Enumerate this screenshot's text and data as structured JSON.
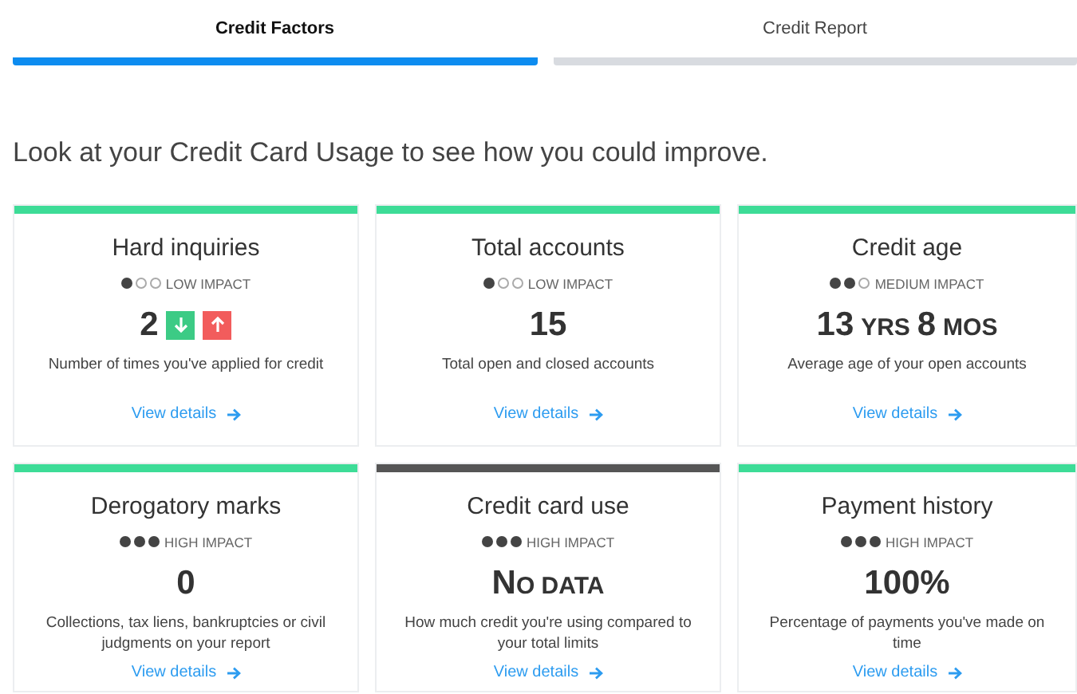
{
  "tabs": [
    {
      "label": "Credit Factors",
      "selected": true
    },
    {
      "label": "Credit Report",
      "selected": false
    }
  ],
  "heading": "Look at your Credit Card Usage to see how you could improve.",
  "cards": [
    {
      "title": "Hard inquiries",
      "color": "#3ddc97",
      "impact_dots": [
        {
          "filled": true
        },
        {
          "filled": false
        },
        {
          "filled": false
        }
      ],
      "impact_label": "LOW IMPACT",
      "value": [
        {
          "kind": "number",
          "text": "2"
        }
      ],
      "trend_buttons": [
        {
          "kind": "down"
        },
        {
          "kind": "up"
        }
      ],
      "description": "Number of times you've applied for credit",
      "link": "View details"
    },
    {
      "title": "Total accounts",
      "color": "#3ddc97",
      "impact_dots": [
        {
          "filled": true
        },
        {
          "filled": false
        },
        {
          "filled": false
        }
      ],
      "impact_label": "LOW IMPACT",
      "value": [
        {
          "kind": "number",
          "text": "15"
        }
      ],
      "description": "Total open and closed accounts",
      "link": "View details"
    },
    {
      "title": "Credit age",
      "color": "#3ddc97",
      "impact_dots": [
        {
          "filled": true
        },
        {
          "filled": true
        },
        {
          "filled": false
        }
      ],
      "impact_label": "MEDIUM IMPACT",
      "value": [
        {
          "kind": "number",
          "text": "13"
        },
        {
          "kind": "unit",
          "text": "YRS"
        },
        {
          "kind": "number",
          "text": "8"
        },
        {
          "kind": "unit",
          "text": "MOS"
        }
      ],
      "description": "Average age of your open accounts",
      "link": "View details"
    },
    {
      "title": "Derogatory marks",
      "color": "#3ddc97",
      "impact_dots": [
        {
          "filled": true
        },
        {
          "filled": true
        },
        {
          "filled": true
        }
      ],
      "impact_label": "HIGH IMPACT",
      "value": [
        {
          "kind": "number",
          "text": "0"
        }
      ],
      "description": "Collections, tax liens, bankruptcies or civil judgments on your report",
      "link": "View details"
    },
    {
      "title": "Credit card use",
      "color": "#555555",
      "impact_dots": [
        {
          "filled": true
        },
        {
          "filled": true
        },
        {
          "filled": true
        }
      ],
      "impact_label": "HIGH IMPACT",
      "value": [
        {
          "kind": "number",
          "text": "N"
        },
        {
          "kind": "unit",
          "text": "O DATA"
        }
      ],
      "description": "How much credit you're using compared to your total limits",
      "link": "View details"
    },
    {
      "title": "Payment history",
      "color": "#3ddc97",
      "impact_dots": [
        {
          "filled": true
        },
        {
          "filled": true
        },
        {
          "filled": true
        }
      ],
      "impact_label": "HIGH IMPACT",
      "value": [
        {
          "kind": "number",
          "text": "100%"
        }
      ],
      "description": "Percentage of payments you've made on time",
      "link": "View details"
    }
  ]
}
